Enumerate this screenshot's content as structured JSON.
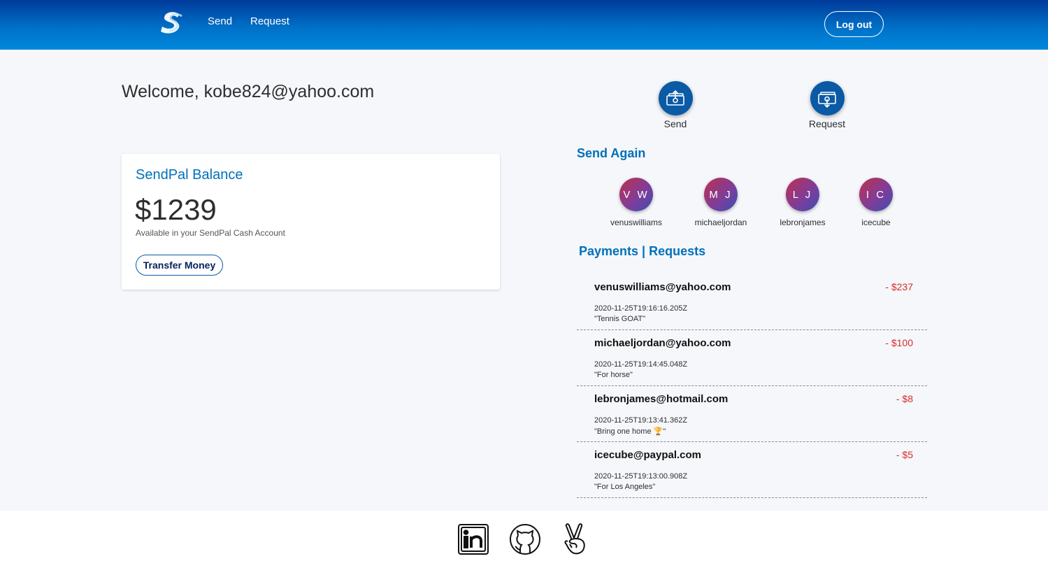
{
  "header": {
    "logo_icon": "sendpal-logo-icon",
    "nav": {
      "send_label": "Send",
      "request_label": "Request"
    },
    "logout_label": "Log out"
  },
  "welcome_text": "Welcome, kobe824@yahoo.com",
  "actions": {
    "send_label": "Send",
    "request_label": "Request"
  },
  "balance_card": {
    "title": "SendPal Balance",
    "amount": "$1239",
    "subtitle": "Available in your SendPal Cash Account",
    "transfer_label": "Transfer Money"
  },
  "send_again": {
    "title": "Send Again",
    "contacts": [
      {
        "initials": "V W",
        "name": "venuswilliams"
      },
      {
        "initials": "M J",
        "name": "michaeljordan"
      },
      {
        "initials": "L J",
        "name": "lebronjames"
      },
      {
        "initials": "I C",
        "name": "icecube"
      }
    ]
  },
  "payments": {
    "title": "Payments | Requests",
    "items": [
      {
        "email": "venuswilliams@yahoo.com",
        "amount": "- $237",
        "date": "2020-11-25T19:16:16.205Z",
        "note": "\"Tennis GOAT\""
      },
      {
        "email": "michaeljordan@yahoo.com",
        "amount": "- $100",
        "date": "2020-11-25T19:14:45.048Z",
        "note": "\"For horse\""
      },
      {
        "email": "lebronjames@hotmail.com",
        "amount": "- $8",
        "date": "2020-11-25T19:13:41.362Z",
        "note": "\"Bring one home 🏆\""
      },
      {
        "email": "icecube@paypal.com",
        "amount": "- $5",
        "date": "2020-11-25T19:13:00.908Z",
        "note": "\"For Los Angeles\""
      }
    ]
  },
  "footer": {
    "icons": [
      "linkedin-icon",
      "github-icon",
      "angellist-icon"
    ]
  },
  "colors": {
    "brand_blue": "#0070ba",
    "header_dark": "#003a9b",
    "negative": "#d92b2b"
  }
}
